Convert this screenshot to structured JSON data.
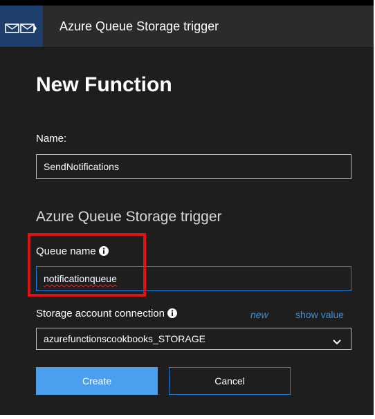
{
  "header": {
    "title": "Azure Queue Storage trigger",
    "icon": "queue-storage-icon"
  },
  "form": {
    "heading": "New Function",
    "name_label": "Name:",
    "name_value": "SendNotifications",
    "section_title": "Azure Queue Storage trigger",
    "queue_label": "Queue name",
    "queue_value": "notificationqueue",
    "storage_label": "Storage account connection",
    "new_link": "new",
    "show_value_link": "show value",
    "storage_value": "azurefunctionscookbooks_STORAGE"
  },
  "actions": {
    "create_label": "Create",
    "cancel_label": "Cancel"
  },
  "colors": {
    "background": "#1e1e1e",
    "accent": "#4aa0ee",
    "highlight": "#e01313"
  }
}
